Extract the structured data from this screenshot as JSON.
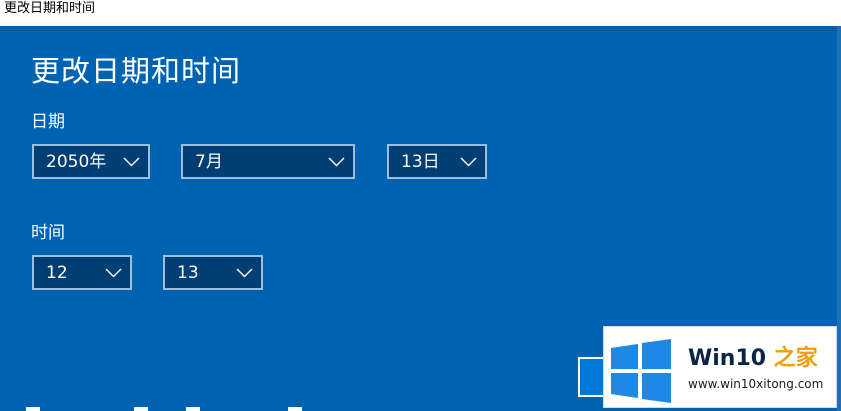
{
  "window": {
    "title": "更改日期和时间"
  },
  "dialog": {
    "heading": "更改日期和时间",
    "date_label": "日期",
    "time_label": "时间",
    "date": {
      "year": "2050年",
      "month": "7月",
      "day": "13日"
    },
    "time": {
      "hour": "12",
      "minute": "13"
    }
  },
  "watermark": {
    "title_prefix": "Win10",
    "title_suffix": "之家",
    "url": "www.win10xitong.com",
    "colors": {
      "logo_blue": "#1e88e5",
      "brand_dark": "#0b2545",
      "brand_orange": "#f39c12"
    }
  },
  "colors": {
    "dialog_bg": "#0063b1",
    "combo_bg": "#003e73",
    "combo_border": "#9bbfdd"
  }
}
